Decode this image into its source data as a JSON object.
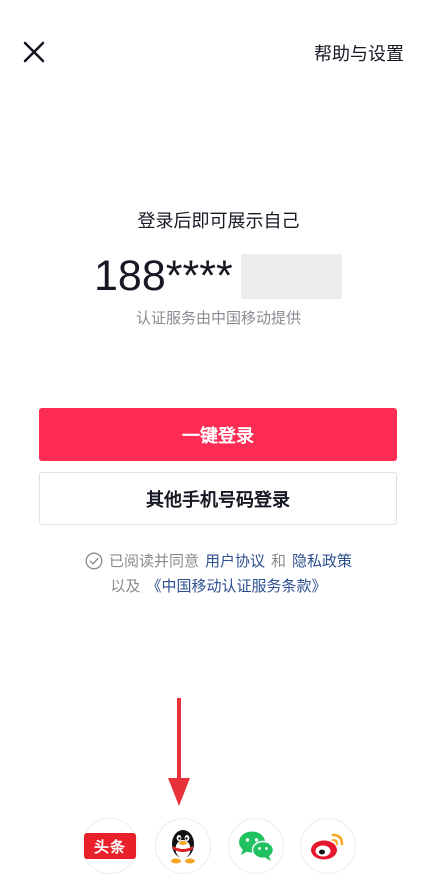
{
  "header": {
    "close_icon": "close-icon",
    "help_label": "帮助与设置"
  },
  "main": {
    "headline": "登录后即可展示自己",
    "phone_masked": "188****",
    "provider_note": "认证服务由中国移动提供",
    "primary_button": "一键登录",
    "secondary_button": "其他手机号码登录"
  },
  "agreement": {
    "prefix": "已阅读并同意",
    "user_agreement": "用户协议",
    "and": "和",
    "privacy_policy": "隐私政策",
    "also": "以及",
    "cmcc_terms": "《中国移动认证服务条款》"
  },
  "social_login": [
    {
      "name": "toutiao",
      "label": "头条",
      "icon": "toutiao-icon"
    },
    {
      "name": "qq",
      "icon": "qq-penguin-icon"
    },
    {
      "name": "wechat",
      "icon": "wechat-icon"
    },
    {
      "name": "weibo",
      "icon": "weibo-icon"
    }
  ],
  "colors": {
    "primary": "#fe2c55",
    "link": "#2c4f8f",
    "annotation_arrow": "#e8323a",
    "toutiao": "#e8202a",
    "wechat": "#20c160"
  }
}
